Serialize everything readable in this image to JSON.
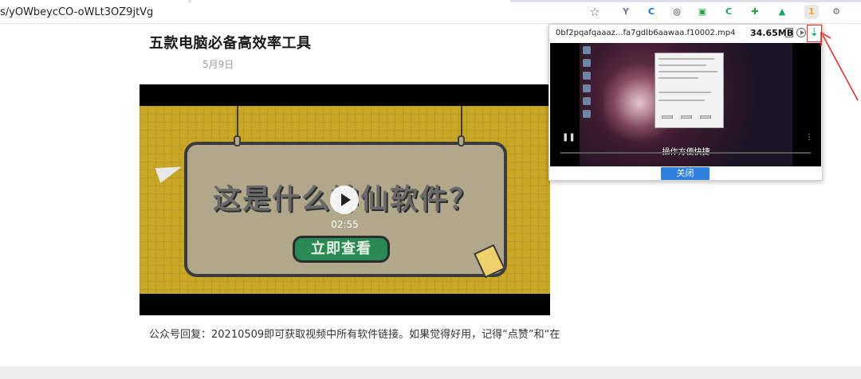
{
  "browser": {
    "url": "s/yOWbeycCO-oWLt3OZ9jtVg",
    "extensions": [
      {
        "name": "bookmark-star-icon"
      },
      {
        "name": "y-extension-icon",
        "glyph": "Y",
        "color": "#6b7a8c"
      },
      {
        "name": "c-blue-extension-icon",
        "glyph": "C",
        "color": "#1a6fd8"
      },
      {
        "name": "chatgpt-extension-icon",
        "glyph": "◎",
        "color": "#222222"
      },
      {
        "name": "green-chat-extension-icon",
        "glyph": "▣",
        "color": "#23a04a"
      },
      {
        "name": "c-teal-extension-icon",
        "glyph": "C",
        "color": "#1aa08a"
      },
      {
        "name": "green-puzzle-extension-icon",
        "glyph": "✚",
        "color": "#2aa048"
      },
      {
        "name": "green-flag-extension-icon",
        "glyph": "▲",
        "color": "#19a266"
      },
      {
        "name": "video-downloader-extension-icon",
        "glyph": "1",
        "color": "#f0a81e"
      },
      {
        "name": "extensions-menu-icon",
        "glyph": "⚙",
        "color": "#5f6368"
      }
    ]
  },
  "article": {
    "title": "五款电脑必备高效率工具",
    "date": "5月9日",
    "video": {
      "poster_text": "这是什么神仙软件？",
      "cta": "立即查看",
      "duration": "02:55"
    },
    "body_text": "公众号回复：20210509即可获取视频中所有软件链接。如果觉得好用，记得“点赞”和“在"
  },
  "popup": {
    "filename": "0bf2pqafqaaaz...fa7gdlb6aawaa.f10002.mp4",
    "size": "34.65MB",
    "preview_subtitle": "操作方便快捷",
    "close_label": "关闭"
  },
  "colors": {
    "accent": "#2f7fe0",
    "annotation": "#e03030",
    "poster_bg": "#c9a626",
    "cta_bg": "#2a8a55"
  }
}
